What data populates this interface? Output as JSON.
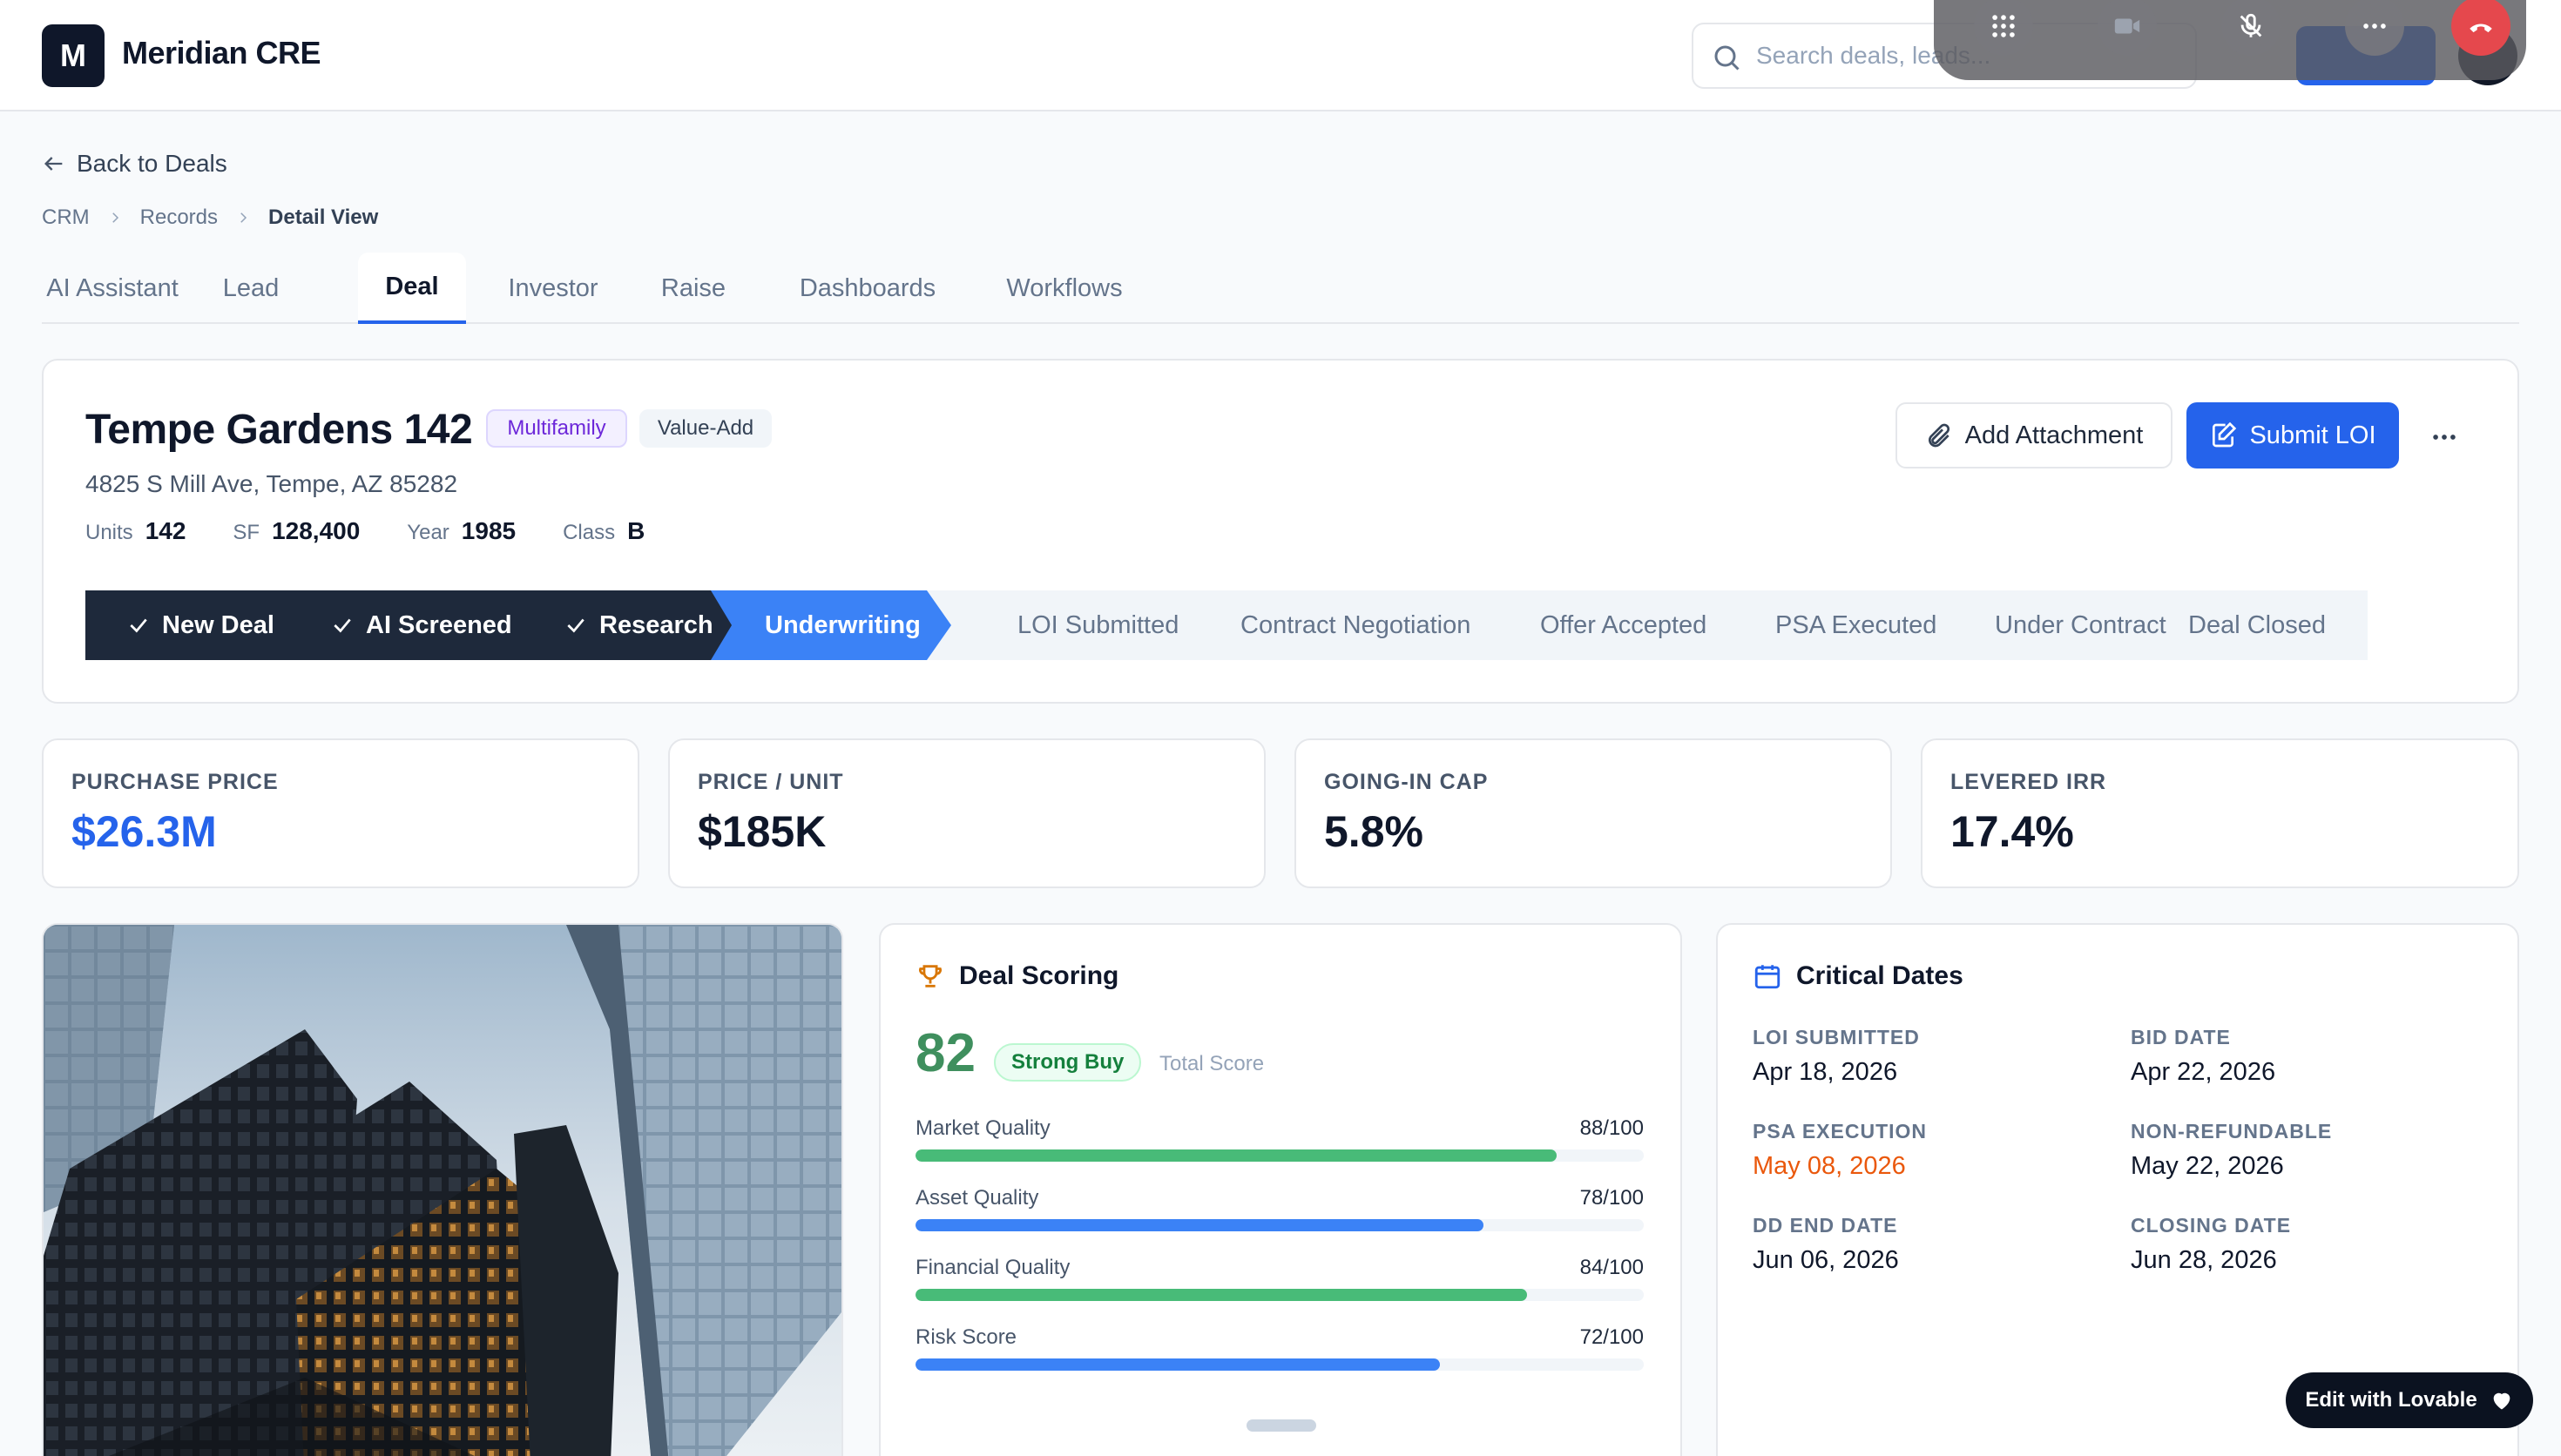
{
  "app": {
    "logo_letter": "M",
    "name": "Meridian CRE"
  },
  "search": {
    "placeholder": "Search deals, leads..."
  },
  "nav": {
    "back_label": "Back to Deals",
    "breadcrumb": [
      "CRM",
      "Records",
      "Detail View"
    ]
  },
  "tabs": [
    "AI Assistant",
    "Lead",
    "Deal",
    "Investor",
    "Raise",
    "Dashboards",
    "Workflows"
  ],
  "active_tab": "Deal",
  "deal": {
    "title": "Tempe Gardens 142",
    "badges": [
      "Multifamily",
      "Value-Add"
    ],
    "address": "4825 S Mill Ave, Tempe, AZ 85282",
    "meta": [
      {
        "label": "Units",
        "value": "142"
      },
      {
        "label": "SF",
        "value": "128,400"
      },
      {
        "label": "Year",
        "value": "1985"
      },
      {
        "label": "Class",
        "value": "B"
      }
    ],
    "add_attachment_label": "Add Attachment",
    "submit_label": "Submit LOI"
  },
  "pipeline": {
    "stages": [
      "New Deal",
      "AI Screened",
      "Research",
      "Underwriting",
      "LOI Submitted",
      "Contract Negotiation",
      "Offer Accepted",
      "PSA Executed",
      "Under Contract",
      "Deal Closed"
    ],
    "completed_count": 3,
    "current_index": 3
  },
  "kpis": [
    {
      "label": "PURCHASE PRICE",
      "value": "$26.3M"
    },
    {
      "label": "PRICE / UNIT",
      "value": "$185K"
    },
    {
      "label": "GOING-IN CAP",
      "value": "5.8%"
    },
    {
      "label": "LEVERED IRR",
      "value": "17.4%"
    }
  ],
  "scoring": {
    "title": "Deal Scoring",
    "score": "82",
    "rating": "Strong Buy",
    "caption": "Total Score",
    "metrics": [
      {
        "label": "Market Quality",
        "display": "88/100",
        "score": 88,
        "color": "#48bb78"
      },
      {
        "label": "Asset Quality",
        "display": "78/100",
        "score": 78,
        "color": "#3b82f6"
      },
      {
        "label": "Financial Quality",
        "display": "84/100",
        "score": 84,
        "color": "#48bb78"
      },
      {
        "label": "Risk Score",
        "display": "72/100",
        "score": 72,
        "color": "#3b82f6"
      }
    ]
  },
  "dates": {
    "title": "Critical Dates",
    "items": [
      {
        "label": "LOI SUBMITTED",
        "value": "Apr 18, 2026"
      },
      {
        "label": "BID DATE",
        "value": "Apr 22, 2026"
      },
      {
        "label": "PSA EXECUTION",
        "value": "May 08, 2026",
        "highlight": true
      },
      {
        "label": "NON-REFUNDABLE",
        "value": "May 22, 2026"
      },
      {
        "label": "DD END DATE",
        "value": "Jun 06, 2026"
      },
      {
        "label": "CLOSING DATE",
        "value": "Jun 28, 2026"
      }
    ]
  },
  "lovable_label": "Edit with Lovable",
  "colors": {
    "primary": "#2563eb",
    "dark": "#1e293b",
    "success": "#3f8f5e",
    "warning": "#ea580c"
  },
  "icons": [
    "search-icon",
    "arrow-left-icon",
    "chevron-right-icon",
    "paperclip-icon",
    "edit-icon",
    "more-icon",
    "check-icon",
    "trophy-icon",
    "calendar-icon",
    "heart-icon",
    "grid-icon",
    "camera-icon",
    "mic-off-icon",
    "end-call-icon"
  ]
}
